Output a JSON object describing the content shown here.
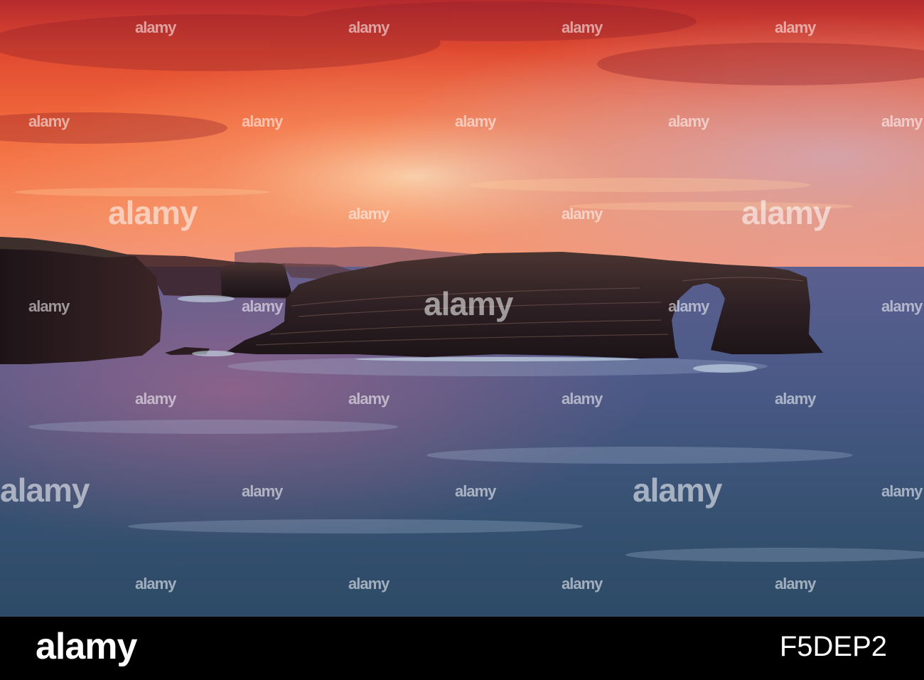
{
  "watermark": {
    "text": "alamy",
    "color": "#ffffff"
  },
  "footer": {
    "logo": "alamy",
    "image_id": "F5DEP2",
    "background": "#000000"
  },
  "scene": {
    "subject": "sea arch rock formation at sunset",
    "colors": {
      "sky_top": "#c8302a",
      "sky_mid": "#f2683a",
      "sky_horizon": "#f7a07a",
      "sea": "#3b4f78",
      "rock": "#2a1c20"
    }
  }
}
